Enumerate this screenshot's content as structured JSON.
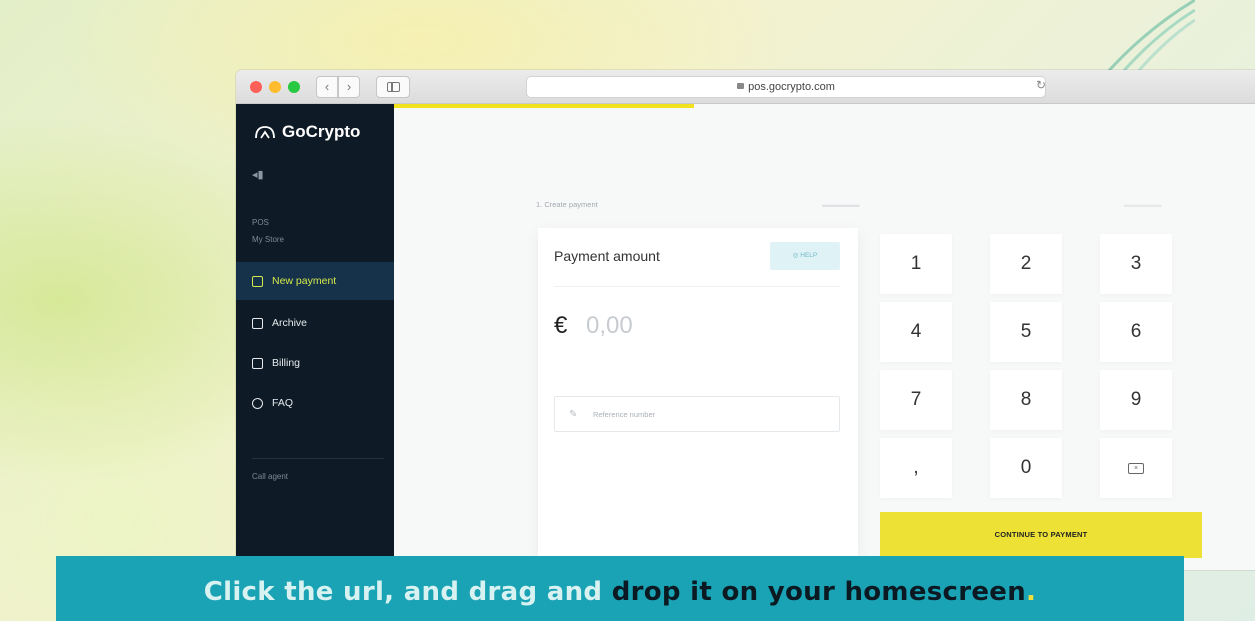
{
  "browser": {
    "url": "pos.gocrypto.com",
    "back_icon": "chevron-left-icon",
    "forward_icon": "chevron-right-icon",
    "back_glyph": "‹",
    "forward_glyph": "›",
    "reload_glyph": "↻"
  },
  "sidebar": {
    "brand": "GoCrypto",
    "section_label": "POS",
    "store_name": "My Store",
    "items": [
      {
        "label": "New payment",
        "icon": "plus-square-icon",
        "active": true
      },
      {
        "label": "Archive",
        "icon": "archive-icon",
        "active": false
      },
      {
        "label": "Billing",
        "icon": "document-icon",
        "active": false
      },
      {
        "label": "FAQ",
        "icon": "globe-icon",
        "active": false
      }
    ],
    "call_agent": "Call agent"
  },
  "steps": {
    "step1": "1. Create payment"
  },
  "payment_card": {
    "title": "Payment amount",
    "help_label": "HELP",
    "currency_symbol": "€",
    "amount_placeholder": "0,00",
    "reference_placeholder": "Reference number"
  },
  "keypad": {
    "keys": [
      "1",
      "2",
      "3",
      "4",
      "5",
      "6",
      "7",
      "8",
      "9",
      ",",
      "0"
    ],
    "backspace_icon": "backspace-icon",
    "continue_label": "CONTINUE TO PAYMENT"
  },
  "caption": {
    "part1": "Click the url, and drag and ",
    "part2": "drop it on your homescreen",
    "part3": "."
  },
  "colors": {
    "sidebar_bg": "#0e1b26",
    "accent_yellow": "#ede135",
    "caption_bg": "#1aa3b4"
  }
}
